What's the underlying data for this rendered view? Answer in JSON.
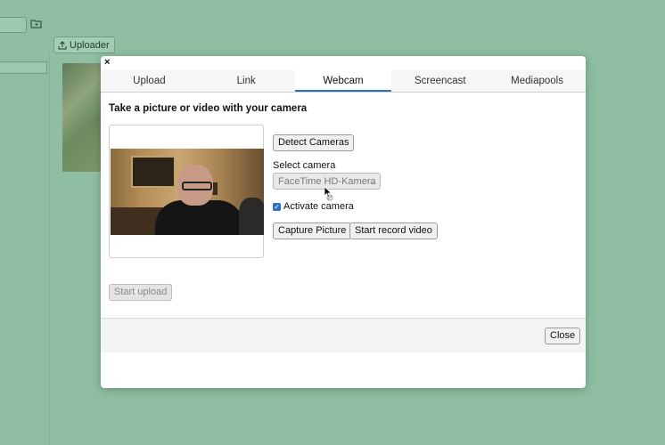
{
  "background": {
    "uploader_label": "Uploader"
  },
  "dialog": {
    "close_x": "×",
    "tabs": [
      "Upload",
      "Link",
      "Webcam",
      "Screencast",
      "Mediapools"
    ],
    "active_tab": "Webcam",
    "heading": "Take a picture or video with your camera",
    "detect_cameras_label": "Detect Cameras",
    "select_camera_label": "Select camera",
    "camera_select_value": "FaceTime HD-Kamera",
    "activate_camera_label": "Activate camera",
    "activate_camera_checked": true,
    "capture_picture_label": "Capture Picture",
    "start_record_label": "Start record video",
    "start_upload_label": "Start upload",
    "close_label": "Close"
  },
  "colors": {
    "page_background": "#8fbea2",
    "active_tab_underline": "#2f6fbf"
  }
}
